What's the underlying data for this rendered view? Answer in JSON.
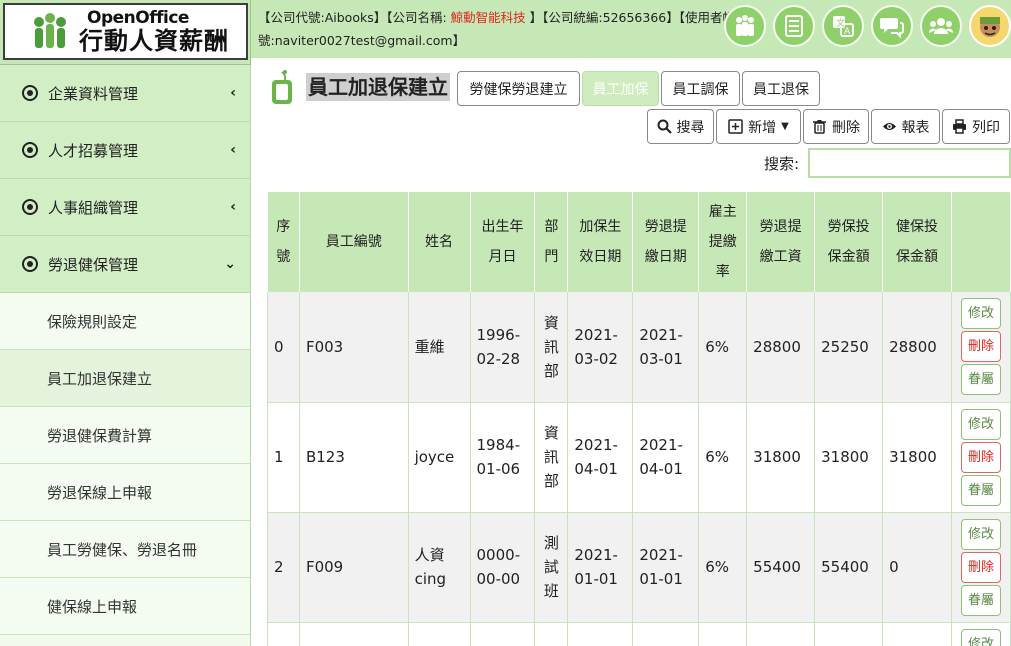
{
  "app": {
    "logo_en": "OpenOffice",
    "logo_zh": "行動人資薪酬"
  },
  "header": {
    "company_code_label": "【公司代號:",
    "company_code": "Aibooks",
    "company_name_label": "】【公司名稱: ",
    "company_name": "鯨動智能科技",
    "tax_id_label": " 】【公司統編:",
    "tax_id": "52656366",
    "account_label": "】【使用者帳號:",
    "account": "naviter0027test@gmail.com",
    "account_close": "】",
    "icons": [
      "people-icon",
      "list-icon",
      "translate-icon",
      "chat-icon",
      "users-icon",
      "avatar"
    ]
  },
  "sidebar": {
    "groups": [
      {
        "label": "企業資料管理",
        "chevron": "‹"
      },
      {
        "label": "人才招募管理",
        "chevron": "‹"
      },
      {
        "label": "人事組織管理",
        "chevron": "‹"
      },
      {
        "label": "勞退健保管理",
        "chevron": "⌄"
      }
    ],
    "subitems": [
      {
        "label": "保險規則設定"
      },
      {
        "label": "員工加退保建立"
      },
      {
        "label": "勞退健保費計算"
      },
      {
        "label": "勞退保線上申報"
      },
      {
        "label": "員工勞健保、勞退名冊"
      },
      {
        "label": "健保線上申報"
      }
    ]
  },
  "page": {
    "title": "員工加退保建立",
    "tabs": [
      {
        "label": "勞健保勞退建立"
      },
      {
        "label": "員工加保"
      },
      {
        "label": "員工調保"
      },
      {
        "label": "員工退保"
      }
    ],
    "toolbar": {
      "search": "搜尋",
      "add": "新增",
      "delete": "刪除",
      "report": "報表",
      "print": "列印"
    },
    "search_label": "搜索:",
    "search_value": ""
  },
  "table": {
    "headers": [
      "序號",
      "員工編號",
      "姓名",
      "出生年月日",
      "部門",
      "加保生效日期",
      "勞退提繳日期",
      "雇主提繳率",
      "勞退提繳工資",
      "勞保投保金額",
      "健保投保金額",
      ""
    ],
    "rows": [
      {
        "no": "0",
        "emp_id": "F003",
        "name": "重維",
        "birth": "1996-02-28",
        "dept": "資訊部",
        "effective": "2021-03-02",
        "pension_date": "2021-03-01",
        "rate": "6%",
        "pension_wage": "28800",
        "labor_amt": "25250",
        "health_amt": "28800"
      },
      {
        "no": "1",
        "emp_id": "B123",
        "name": "joyce",
        "birth": "1984-01-06",
        "dept": "資訊部",
        "effective": "2021-04-01",
        "pension_date": "2021-04-01",
        "rate": "6%",
        "pension_wage": "31800",
        "labor_amt": "31800",
        "health_amt": "31800"
      },
      {
        "no": "2",
        "emp_id": "F009",
        "name": "人資cing",
        "birth": "0000-00-00",
        "dept": "測試班",
        "effective": "2021-01-01",
        "pension_date": "2021-01-01",
        "rate": "6%",
        "pension_wage": "55400",
        "labor_amt": "55400",
        "health_amt": "0"
      }
    ],
    "actions": {
      "edit": "修改",
      "delete": "刪除",
      "copy": "眷屬"
    },
    "partial_action": "修改"
  }
}
